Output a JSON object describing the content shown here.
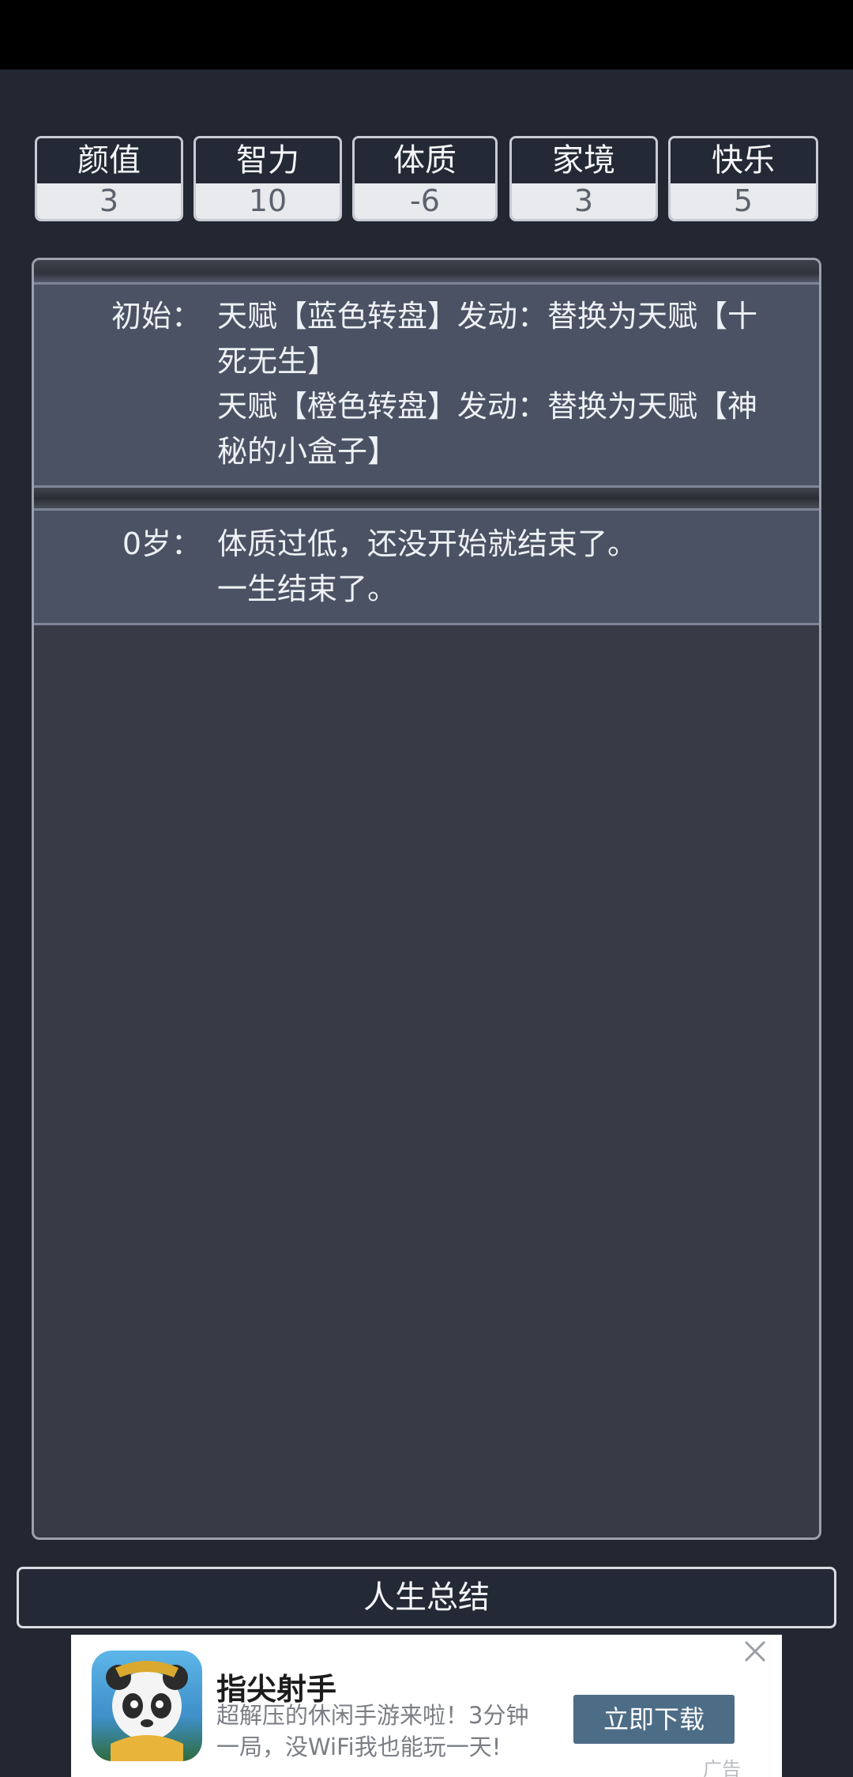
{
  "props": [
    {
      "name": "颜值",
      "value": "3"
    },
    {
      "name": "智力",
      "value": "10"
    },
    {
      "name": "体质",
      "value": "-6"
    },
    {
      "name": "家境",
      "value": "3"
    },
    {
      "name": "快乐",
      "value": "5"
    }
  ],
  "trajectory": [
    {
      "age": "初始：",
      "lines": [
        "天赋【蓝色转盘】发动：替换为天赋【十",
        "死无生】",
        "天赋【橙色转盘】发动：替换为天赋【神",
        "秘的小盒子】"
      ]
    },
    {
      "age": "0岁：",
      "lines": [
        "体质过低，还没开始就结束了。",
        "一生结束了。"
      ]
    }
  ],
  "summary_button": "人生总结",
  "ad": {
    "title": "指尖射手",
    "desc_line1": "超解压的休闲手游来啦！3分钟",
    "desc_line2": "一局，没WiFi我也能玩一天!",
    "cta": "立即下载",
    "badge": "广告",
    "close_icon": "close-icon"
  },
  "colors": {
    "background": "#222731",
    "panel": "#373b45",
    "entry": "#4a5263",
    "cta": "#4d6c86"
  }
}
